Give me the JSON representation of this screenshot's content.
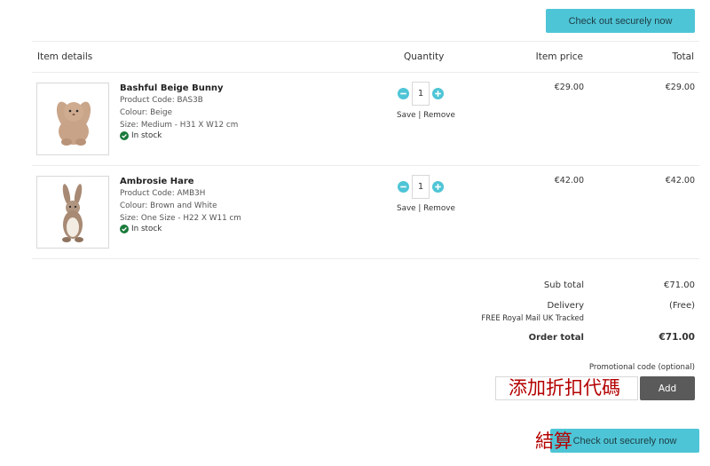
{
  "checkout_label": "Check out securely now",
  "table": {
    "headers": {
      "item_details": "Item details",
      "quantity": "Quantity",
      "item_price": "Item price",
      "total": "Total"
    }
  },
  "items": [
    {
      "name": "Bashful Beige Bunny",
      "code": "Product Code: BAS3B",
      "colour": "Colour: Beige",
      "size": "Size: Medium - H31 X W12 cm",
      "stock": "In stock",
      "quantity": "1",
      "save": "Save",
      "separator": "|",
      "remove": "Remove",
      "price": "€29.00",
      "total": "€29.00"
    },
    {
      "name": "Ambrosie Hare",
      "code": "Product Code: AMB3H",
      "colour": "Colour: Brown and White",
      "size": "Size: One Size - H22 X W11 cm",
      "stock": "In stock",
      "quantity": "1",
      "save": "Save",
      "separator": "|",
      "remove": "Remove",
      "price": "€42.00",
      "total": "€42.00"
    }
  ],
  "summary": {
    "subtotal_label": "Sub total",
    "subtotal_value": "€71.00",
    "delivery_label": "Delivery",
    "delivery_value": "(Free)",
    "delivery_note": "FREE Royal Mail UK Tracked",
    "order_total_label": "Order total",
    "order_total_value": "€71.00"
  },
  "promo": {
    "label": "Promotional code (optional)",
    "overlay_text": "添加折扣代碼",
    "value": "",
    "add_label": "Add"
  },
  "bottom_overlay_text": "結算",
  "colors": {
    "accent": "#4ec5d6",
    "add_button": "#5a5a5a",
    "in_stock": "#1a7a3a",
    "overlay_text": "#b40000"
  }
}
